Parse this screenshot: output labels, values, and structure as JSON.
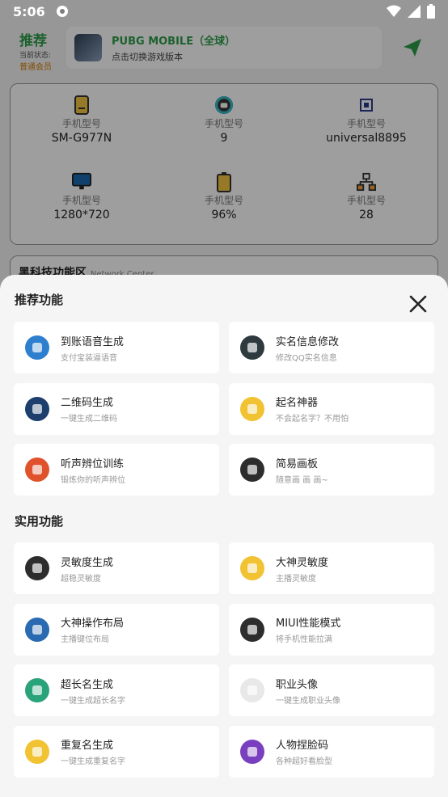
{
  "status_bar": {
    "time": "5:06"
  },
  "header": {
    "title": "推荐",
    "status_label": "当前状态:",
    "membership": "普通会员",
    "game_name": "PUBG MOBILE（全球）",
    "game_hint": "点击切换游戏版本"
  },
  "device_info": [
    {
      "label": "手机型号",
      "value": "SM-G977N",
      "icon": "phone-icon"
    },
    {
      "label": "手机型号",
      "value": "9",
      "icon": "android-icon"
    },
    {
      "label": "手机型号",
      "value": "universal8895",
      "icon": "cpu-icon"
    },
    {
      "label": "手机型号",
      "value": "1280*720",
      "icon": "monitor-icon"
    },
    {
      "label": "手机型号",
      "value": "96%",
      "icon": "battery-icon"
    },
    {
      "label": "手机型号",
      "value": "28",
      "icon": "network-icon"
    }
  ],
  "black_tech": {
    "title": "黑科技功能区",
    "subtitle": "Network Center"
  },
  "sheet": {
    "recommended_title": "推荐功能",
    "practical_title": "实用功能",
    "recommended": [
      {
        "title": "到账语音生成",
        "subtitle": "支付宝装逼语音",
        "icon": "payment-voice-icon"
      },
      {
        "title": "实名信息修改",
        "subtitle": "修改QQ实名信息",
        "icon": "plant-pot-icon"
      },
      {
        "title": "二维码生成",
        "subtitle": "一键生成二维码",
        "icon": "qrcode-icon"
      },
      {
        "title": "起名神器",
        "subtitle": "不会起名字？不用怕",
        "icon": "pen-icon"
      },
      {
        "title": "听声辨位训练",
        "subtitle": "锻炼你的听声辨位",
        "icon": "soldier-icon"
      },
      {
        "title": "简易画板",
        "subtitle": "随意画 画 画~",
        "icon": "palette-icon"
      }
    ],
    "practical": [
      {
        "title": "灵敏度生成",
        "subtitle": "超稳灵敏度",
        "icon": "laptop-icon"
      },
      {
        "title": "大神灵敏度",
        "subtitle": "主播灵敏度",
        "icon": "monitor-icon"
      },
      {
        "title": "大神操作布局",
        "subtitle": "主播键位布局",
        "icon": "tablet-icon"
      },
      {
        "title": "MIUI性能模式",
        "subtitle": "将手机性能拉满",
        "icon": "rocket-icon"
      },
      {
        "title": "超长名生成",
        "subtitle": "一键生成超长名字",
        "icon": "flask-icon"
      },
      {
        "title": "职业头像",
        "subtitle": "一键生成职业头像",
        "icon": "avatar-icon"
      },
      {
        "title": "重复名生成",
        "subtitle": "一键生成重复名字",
        "icon": "ticket-icon"
      },
      {
        "title": "人物捏脸码",
        "subtitle": "各种超好看脸型",
        "icon": "pill-icon"
      }
    ]
  },
  "colors": {
    "accent": "#2e9d4a",
    "vip": "#d27b00"
  }
}
